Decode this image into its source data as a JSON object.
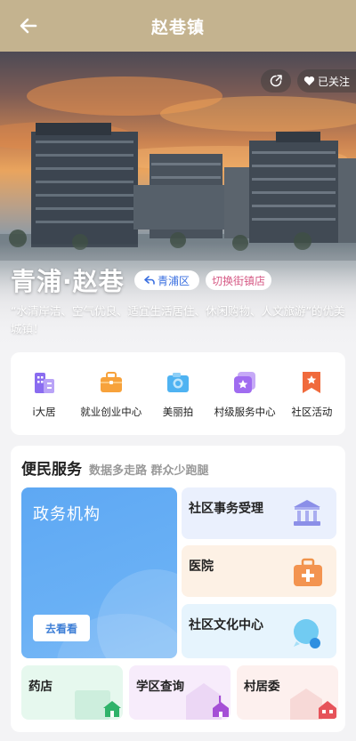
{
  "header": {
    "title": "赵巷镇",
    "back_icon": "arrow-left-icon"
  },
  "hero": {
    "town_name": "青浦·赵巷",
    "district_tag": "青浦区",
    "switch_label": "切换街镇店",
    "follow_label": "已关注",
    "slogan": "“水清岸洁、空气优良、适宜生活居住、休闲购物、人文旅游”的优美城镇！"
  },
  "quick_menu": [
    {
      "label": "i大居",
      "icon": "building-icon",
      "color": "#8a6cf0"
    },
    {
      "label": "就业创业中心",
      "icon": "briefcase-icon",
      "color": "#f7a23b"
    },
    {
      "label": "美丽拍",
      "icon": "camera-icon",
      "color": "#4fb3f2"
    },
    {
      "label": "村级服务中心",
      "icon": "star-card-icon",
      "color": "#a06cf0"
    },
    {
      "label": "社区活动",
      "icon": "bookmark-star-icon",
      "color": "#f06a3c"
    }
  ],
  "services": {
    "title": "便民服务",
    "subtitle": "数据多走路 群众少跑腿",
    "main": {
      "title": "政务机构",
      "button": "去看看"
    },
    "tiles": [
      {
        "label": "社区事务受理",
        "icon": "government-building-icon"
      },
      {
        "label": "医院",
        "icon": "medical-kit-icon"
      },
      {
        "label": "社区文化中心",
        "icon": "chat-bubble-icon"
      }
    ],
    "small_tiles": [
      {
        "label": "药店",
        "icon": "pharmacy-icon"
      },
      {
        "label": "学区查询",
        "icon": "school-icon"
      },
      {
        "label": "村居委",
        "icon": "village-house-icon"
      }
    ]
  }
}
